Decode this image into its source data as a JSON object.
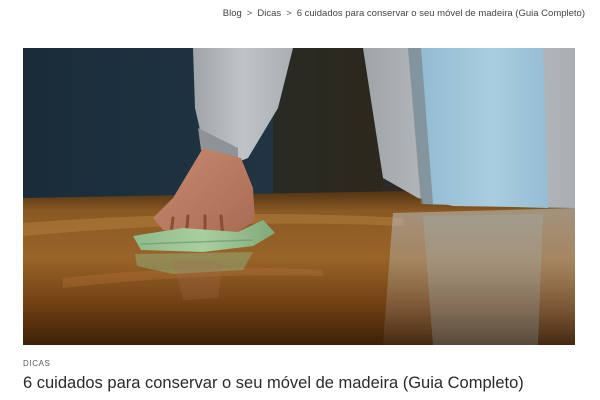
{
  "breadcrumb": {
    "items": [
      {
        "label": "Blog"
      },
      {
        "label": "Dicas"
      }
    ],
    "separator": ">",
    "current": "6 cuidados para conservar o seu móvel de madeira (Guia Completo)"
  },
  "post": {
    "category": "DICAS",
    "title": "6 cuidados para conservar o seu móvel de madeira (Guia Completo)"
  },
  "colors": {
    "text": "#2a2a2a",
    "muted": "#5a5a5a",
    "background": "#ffffff"
  }
}
